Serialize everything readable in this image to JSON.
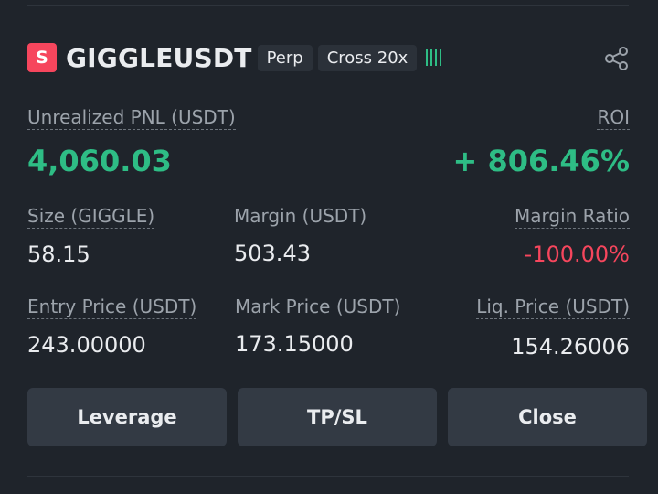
{
  "header": {
    "coin_letter": "S",
    "symbol": "GIGGLEUSDT",
    "type_tag": "Perp",
    "margin_tag": "Cross 20x",
    "colors": {
      "badge": "#f6465d",
      "positive": "#2ebd85",
      "negative": "#f6465d"
    }
  },
  "pnl": {
    "label": "Unrealized PNL (USDT)",
    "value": "4,060.03",
    "roi_label": "ROI",
    "roi_value": "+ 806.46%"
  },
  "stats_row1": {
    "size_label": "Size (GIGGLE)",
    "size_value": "58.15",
    "margin_label": "Margin (USDT)",
    "margin_value": "503.43",
    "ratio_label": "Margin Ratio",
    "ratio_value": "-100.00%"
  },
  "stats_row2": {
    "entry_label": "Entry Price (USDT)",
    "entry_value": "243.00000",
    "mark_label": "Mark Price (USDT)",
    "mark_value": "173.15000",
    "liq_label": "Liq. Price (USDT)",
    "liq_value": "154.26006"
  },
  "actions": {
    "leverage_label": "Leverage",
    "tpsl_label": "TP/SL",
    "close_label": "Close"
  },
  "icons": [
    "share-icon",
    "signal-bars-icon"
  ]
}
